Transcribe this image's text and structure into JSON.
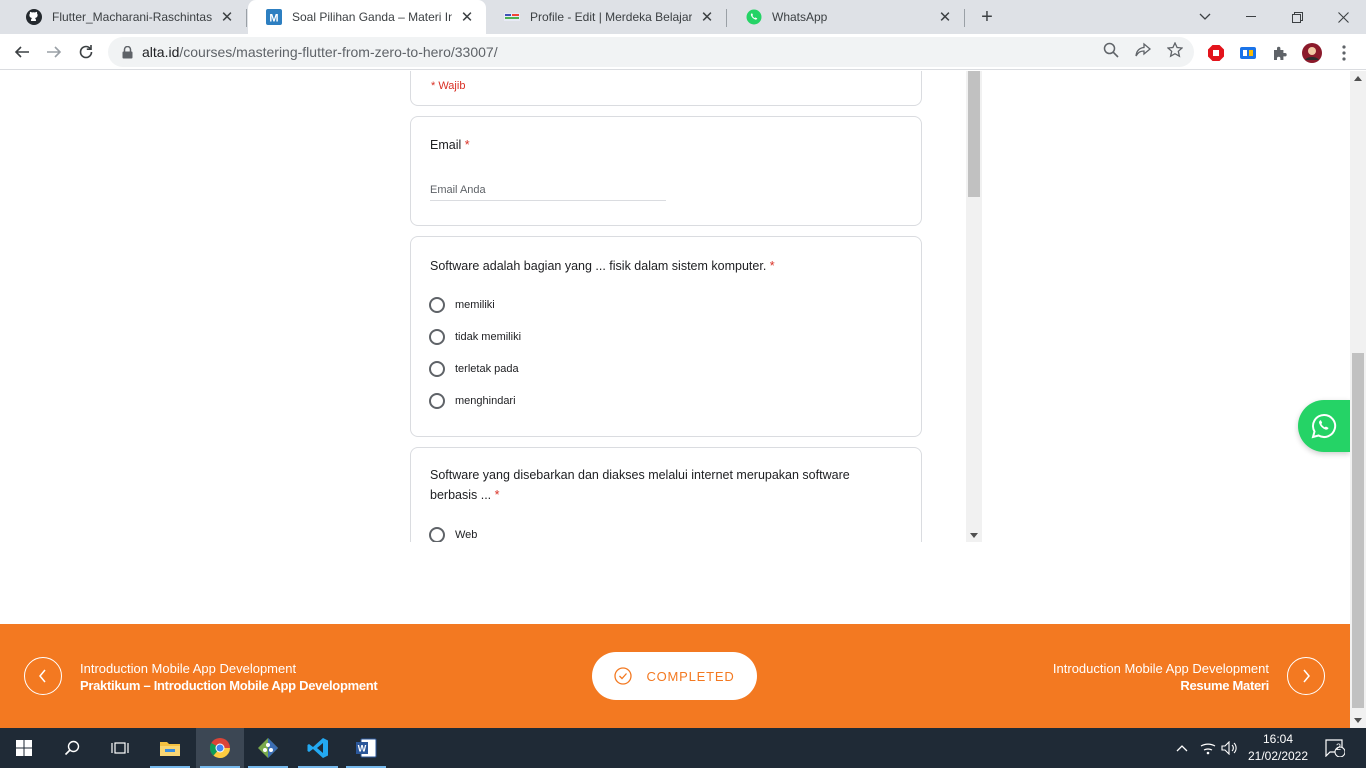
{
  "browser": {
    "tabs": [
      {
        "title": "Flutter_Macharani-Raschintasofi/",
        "favicon": "github-icon",
        "active": false
      },
      {
        "title": "Soal Pilihan Ganda – Materi Intro",
        "favicon": "m-icon",
        "active": true
      },
      {
        "title": "Profile - Edit | Merdeka Belajar - K",
        "favicon": "kampus-merdeka-icon",
        "active": false
      },
      {
        "title": "WhatsApp",
        "favicon": "whatsapp-icon",
        "active": false
      }
    ],
    "new_tab_label": "+",
    "url_host": "alta.id",
    "url_path": "/courses/mastering-flutter-from-zero-to-hero/33007/"
  },
  "form": {
    "required_note": "* Wajib",
    "email": {
      "label": "Email",
      "required_mark": "*",
      "placeholder": "Email Anda"
    },
    "questions": [
      {
        "text": "Software adalah bagian yang ... fisik dalam sistem komputer.",
        "required_mark": "*",
        "options": [
          "memiliki",
          "tidak memiliki",
          "terletak pada",
          "menghindari"
        ]
      },
      {
        "text": "Software yang disebarkan dan diakses melalui internet merupakan software berbasis ...",
        "required_mark": "*",
        "options": [
          "Web"
        ]
      }
    ]
  },
  "footer": {
    "prev": {
      "subtitle": "Introduction Mobile App Development",
      "title": "Praktikum – Introduction Mobile App Development"
    },
    "next": {
      "subtitle": "Introduction Mobile App Development",
      "title": "Resume Materi"
    },
    "completed_label": "COMPLETED",
    "accent_color": "#f37921"
  },
  "taskbar": {
    "time": "16:04",
    "date": "21/02/2022",
    "notification_count": "2"
  }
}
